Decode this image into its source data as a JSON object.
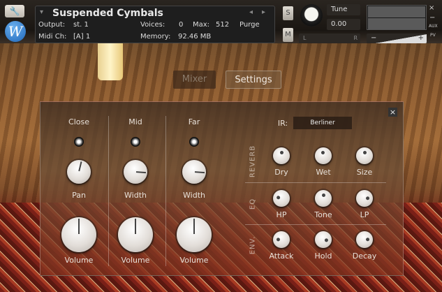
{
  "header": {
    "instrument_name": "Suspended Cymbals",
    "output_label": "Output:",
    "output_value": "st. 1",
    "midi_label": "Midi Ch:",
    "midi_value": "[A]  1",
    "voices_label": "Voices:",
    "voices_value": "0",
    "max_label": "Max:",
    "max_value": "512",
    "memory_label": "Memory:",
    "memory_value": "92.46 MB",
    "purge_label": "Purge",
    "solo_label": "S",
    "mute_label": "M",
    "tune_label": "Tune",
    "tune_value": "0.00",
    "pan_left": "L",
    "pan_right": "R",
    "vol_minus": "−",
    "vol_plus": "+",
    "aux_label": "AUX",
    "pv_label": "PV",
    "close_label": "×",
    "minimize_label": "−"
  },
  "tabs": {
    "mixer": "Mixer",
    "settings": "Settings"
  },
  "mixer": {
    "channels": [
      {
        "name": "Close",
        "small_label": "Pan",
        "small_value": 0.55,
        "volume_label": "Volume",
        "volume_value": 0.5
      },
      {
        "name": "Mid",
        "small_label": "Width",
        "small_value": 0.85,
        "volume_label": "Volume",
        "volume_value": 0.5
      },
      {
        "name": "Far",
        "small_label": "Width",
        "small_value": 0.85,
        "volume_label": "Volume",
        "volume_value": 0.5
      }
    ]
  },
  "effects": {
    "close_label": "×",
    "ir_label": "IR:",
    "ir_value": "Berliner",
    "sections": [
      {
        "name": "REVERB",
        "knobs": [
          {
            "label": "Dry",
            "value": 0.5
          },
          {
            "label": "Wet",
            "value": 0.45
          },
          {
            "label": "Size",
            "value": 0.5
          }
        ]
      },
      {
        "name": "EQ",
        "knobs": [
          {
            "label": "HP",
            "value": 0.2
          },
          {
            "label": "Tone",
            "value": 0.5
          },
          {
            "label": "LP",
            "value": 0.8
          }
        ]
      },
      {
        "name": "ENV.",
        "knobs": [
          {
            "label": "Attack",
            "value": 0.15
          },
          {
            "label": "Hold",
            "value": 0.85
          },
          {
            "label": "Decay",
            "value": 0.8
          }
        ]
      }
    ]
  }
}
